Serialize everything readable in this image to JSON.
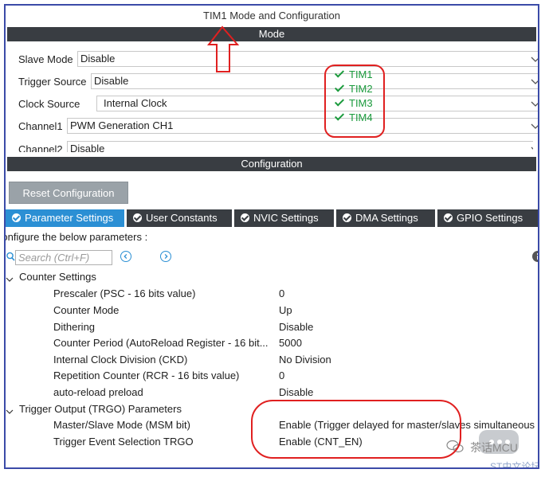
{
  "window": {
    "title": "TIM1 Mode and Configuration"
  },
  "mode_section": {
    "header": "Mode",
    "rows": [
      {
        "label": "Slave Mode",
        "value": "Disable"
      },
      {
        "label": "Trigger Source",
        "value": "Disable"
      },
      {
        "label": "Clock Source",
        "value": "Internal Clock"
      },
      {
        "label": "Channel1",
        "value": "PWM Generation CH1"
      },
      {
        "label": "Channel2",
        "value": "Disable"
      }
    ]
  },
  "tim_list": [
    "TIM1",
    "TIM2",
    "TIM3",
    "TIM4"
  ],
  "config_section": {
    "header": "Configuration",
    "reset_button": "Reset Configuration",
    "tabs": [
      "Parameter Settings",
      "User Constants",
      "NVIC Settings",
      "DMA Settings",
      "GPIO Settings"
    ],
    "hint": "Configure the below parameters :",
    "search_placeholder": "Search (Ctrl+F)",
    "groups": [
      {
        "title": "Counter Settings",
        "params": [
          {
            "name": "Prescaler (PSC - 16 bits value)",
            "value": "0"
          },
          {
            "name": "Counter Mode",
            "value": "Up"
          },
          {
            "name": "Dithering",
            "value": "Disable"
          },
          {
            "name": "Counter Period (AutoReload Register - 16 bit...",
            "value": "5000"
          },
          {
            "name": "Internal Clock Division (CKD)",
            "value": "No Division"
          },
          {
            "name": "Repetition Counter (RCR - 16 bits value)",
            "value": "0"
          },
          {
            "name": "auto-reload preload",
            "value": "Disable"
          }
        ]
      },
      {
        "title": "Trigger Output (TRGO) Parameters",
        "params": [
          {
            "name": "Master/Slave Mode (MSM bit)",
            "value": "Enable (Trigger delayed for master/slaves simultaneous"
          },
          {
            "name": "Trigger Event Selection TRGO",
            "value": "Enable (CNT_EN)"
          }
        ]
      }
    ]
  },
  "watermark": {
    "line1": "茶话MCU",
    "line2": "ST中文论坛"
  },
  "colors": {
    "accent": "#2b8fd4",
    "dark_bar": "#393d42",
    "annotation_red": "#e02020",
    "tim_green": "#1a9a3c"
  }
}
